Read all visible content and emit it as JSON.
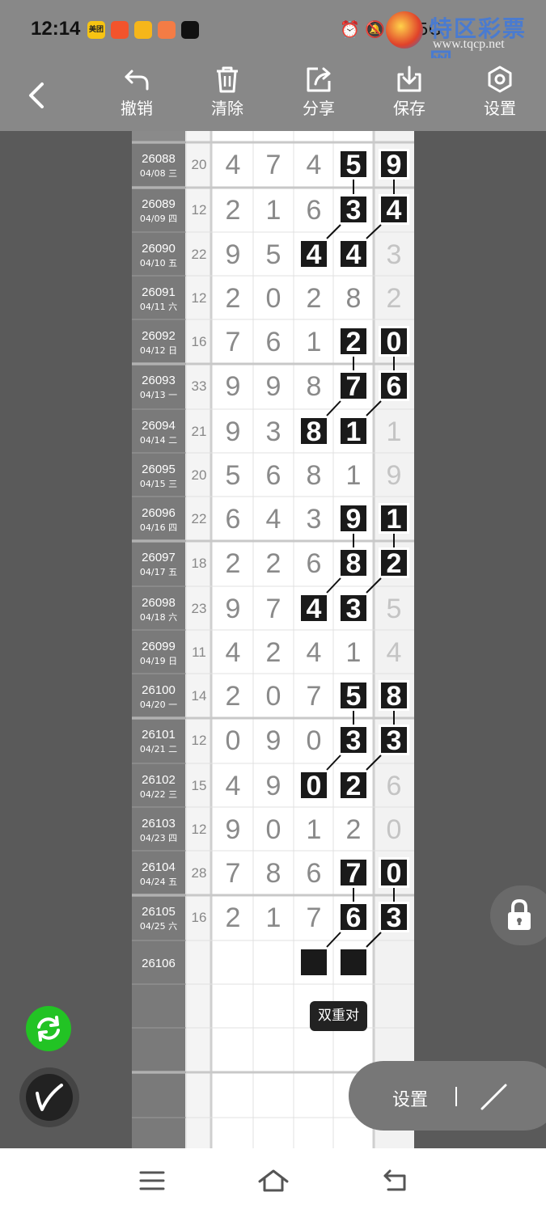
{
  "status_bar": {
    "time": "12:14",
    "app_icons": [
      {
        "name": "meituan-icon",
        "color": "#f7c412",
        "label": "美团"
      },
      {
        "name": "taobao-icon",
        "color": "#f2542c"
      },
      {
        "name": "yellow-app-icon",
        "color": "#f6b61a"
      },
      {
        "name": "video-app-icon",
        "color": "#f47c45"
      },
      {
        "name": "tiktok-icon",
        "color": "#111111"
      }
    ],
    "system_icons": "⏰ 🔕 5G 5G"
  },
  "watermark": {
    "title": "特区彩票网",
    "url": "www.tqcp.net"
  },
  "toolbar": {
    "undo_label": "撤销",
    "clear_label": "清除",
    "share_label": "分享",
    "save_label": "保存",
    "settings_label": "设置"
  },
  "grid": {
    "rows": [
      {
        "issue": "26088",
        "date": "04/08 三",
        "sum": "20",
        "digits": [
          "4",
          "7",
          "4",
          "5",
          "9"
        ],
        "boxed": [
          3,
          4
        ],
        "group_start": true
      },
      {
        "issue": "26089",
        "date": "04/09 四",
        "sum": "12",
        "digits": [
          "2",
          "1",
          "6",
          "3",
          "4"
        ],
        "boxed": [
          3,
          4
        ],
        "group_start": true
      },
      {
        "issue": "26090",
        "date": "04/10 五",
        "sum": "22",
        "digits": [
          "9",
          "5",
          "4",
          "4",
          "3"
        ],
        "boxed": [
          2,
          3
        ],
        "group_start": false
      },
      {
        "issue": "26091",
        "date": "04/11 六",
        "sum": "12",
        "digits": [
          "2",
          "0",
          "2",
          "8",
          "2"
        ],
        "boxed": [],
        "group_start": false
      },
      {
        "issue": "26092",
        "date": "04/12 日",
        "sum": "16",
        "digits": [
          "7",
          "6",
          "1",
          "2",
          "0"
        ],
        "boxed": [
          3,
          4
        ],
        "group_start": false
      },
      {
        "issue": "26093",
        "date": "04/13 一",
        "sum": "33",
        "digits": [
          "9",
          "9",
          "8",
          "7",
          "6"
        ],
        "boxed": [
          3,
          4
        ],
        "group_start": true
      },
      {
        "issue": "26094",
        "date": "04/14 二",
        "sum": "21",
        "digits": [
          "9",
          "3",
          "8",
          "1",
          "1"
        ],
        "boxed": [
          2,
          3
        ],
        "group_start": false
      },
      {
        "issue": "26095",
        "date": "04/15 三",
        "sum": "20",
        "digits": [
          "5",
          "6",
          "8",
          "1",
          "9"
        ],
        "boxed": [],
        "group_start": false
      },
      {
        "issue": "26096",
        "date": "04/16 四",
        "sum": "22",
        "digits": [
          "6",
          "4",
          "3",
          "9",
          "1"
        ],
        "boxed": [
          3,
          4
        ],
        "group_start": false
      },
      {
        "issue": "26097",
        "date": "04/17 五",
        "sum": "18",
        "digits": [
          "2",
          "2",
          "6",
          "8",
          "2"
        ],
        "boxed": [
          3,
          4
        ],
        "group_start": true
      },
      {
        "issue": "26098",
        "date": "04/18 六",
        "sum": "23",
        "digits": [
          "9",
          "7",
          "4",
          "3",
          "5"
        ],
        "boxed": [
          2,
          3
        ],
        "group_start": false
      },
      {
        "issue": "26099",
        "date": "04/19 日",
        "sum": "11",
        "digits": [
          "4",
          "2",
          "4",
          "1",
          "4"
        ],
        "boxed": [],
        "group_start": false
      },
      {
        "issue": "26100",
        "date": "04/20 一",
        "sum": "14",
        "digits": [
          "2",
          "0",
          "7",
          "5",
          "8"
        ],
        "boxed": [
          3,
          4
        ],
        "group_start": false
      },
      {
        "issue": "26101",
        "date": "04/21 二",
        "sum": "12",
        "digits": [
          "0",
          "9",
          "0",
          "3",
          "3"
        ],
        "boxed": [
          3,
          4
        ],
        "group_start": true
      },
      {
        "issue": "26102",
        "date": "04/22 三",
        "sum": "15",
        "digits": [
          "4",
          "9",
          "0",
          "2",
          "6"
        ],
        "boxed": [
          2,
          3
        ],
        "group_start": false
      },
      {
        "issue": "26103",
        "date": "04/23 四",
        "sum": "12",
        "digits": [
          "9",
          "0",
          "1",
          "2",
          "0"
        ],
        "boxed": [],
        "group_start": false
      },
      {
        "issue": "26104",
        "date": "04/24 五",
        "sum": "28",
        "digits": [
          "7",
          "8",
          "6",
          "7",
          "0"
        ],
        "boxed": [
          3,
          4
        ],
        "group_start": false
      },
      {
        "issue": "26105",
        "date": "04/25 六",
        "sum": "16",
        "digits": [
          "2",
          "1",
          "7",
          "6",
          "3"
        ],
        "boxed": [
          3,
          4
        ],
        "group_start": true
      },
      {
        "issue": "26106",
        "date": "",
        "sum": "",
        "digits": [
          "",
          "",
          "",
          "",
          ""
        ],
        "boxed": [
          2,
          3
        ],
        "group_start": false
      },
      {
        "issue": "",
        "date": "",
        "sum": "",
        "digits": [
          "",
          "",
          "",
          "",
          ""
        ],
        "boxed": [],
        "group_start": false
      },
      {
        "issue": "",
        "date": "",
        "sum": "",
        "digits": [
          "",
          "",
          "",
          "",
          ""
        ],
        "boxed": [],
        "group_start": false
      },
      {
        "issue": "",
        "date": "",
        "sum": "",
        "digits": [
          "",
          "",
          "",
          "",
          ""
        ],
        "boxed": [],
        "group_start": true
      },
      {
        "issue": "",
        "date": "",
        "sum": "",
        "digits": [
          "",
          "",
          "",
          "",
          ""
        ],
        "boxed": [],
        "group_start": false
      }
    ],
    "links": [
      {
        "from_row": 0,
        "from_col": 3,
        "to_row": 1,
        "to_col": 3
      },
      {
        "from_row": 0,
        "from_col": 4,
        "to_row": 1,
        "to_col": 4
      },
      {
        "from_row": 1,
        "from_col": 3,
        "to_row": 2,
        "to_col": 2
      },
      {
        "from_row": 1,
        "from_col": 4,
        "to_row": 2,
        "to_col": 3
      },
      {
        "from_row": 4,
        "from_col": 3,
        "to_row": 5,
        "to_col": 3
      },
      {
        "from_row": 4,
        "from_col": 4,
        "to_row": 5,
        "to_col": 4
      },
      {
        "from_row": 5,
        "from_col": 3,
        "to_row": 6,
        "to_col": 2
      },
      {
        "from_row": 5,
        "from_col": 4,
        "to_row": 6,
        "to_col": 3
      },
      {
        "from_row": 8,
        "from_col": 3,
        "to_row": 9,
        "to_col": 3
      },
      {
        "from_row": 8,
        "from_col": 4,
        "to_row": 9,
        "to_col": 4
      },
      {
        "from_row": 9,
        "from_col": 3,
        "to_row": 10,
        "to_col": 2
      },
      {
        "from_row": 9,
        "from_col": 4,
        "to_row": 10,
        "to_col": 3
      },
      {
        "from_row": 12,
        "from_col": 3,
        "to_row": 13,
        "to_col": 3
      },
      {
        "from_row": 12,
        "from_col": 4,
        "to_row": 13,
        "to_col": 4
      },
      {
        "from_row": 13,
        "from_col": 3,
        "to_row": 14,
        "to_col": 2
      },
      {
        "from_row": 13,
        "from_col": 4,
        "to_row": 14,
        "to_col": 3
      },
      {
        "from_row": 16,
        "from_col": 3,
        "to_row": 17,
        "to_col": 3
      },
      {
        "from_row": 16,
        "from_col": 4,
        "to_row": 17,
        "to_col": 4
      },
      {
        "from_row": 17,
        "from_col": 3,
        "to_row": 18,
        "to_col": 2
      },
      {
        "from_row": 17,
        "from_col": 4,
        "to_row": 18,
        "to_col": 3
      }
    ]
  },
  "tooltip": {
    "label": "双重对"
  },
  "settings_pill": {
    "label": "设置"
  },
  "colors": {
    "issue_column_bg": "#7a7a7a",
    "digit_gray": "#8a8a8a",
    "box_fill": "#1a1a1a",
    "grid_line": "#e0e0e0",
    "accent_green": "#22c324"
  }
}
